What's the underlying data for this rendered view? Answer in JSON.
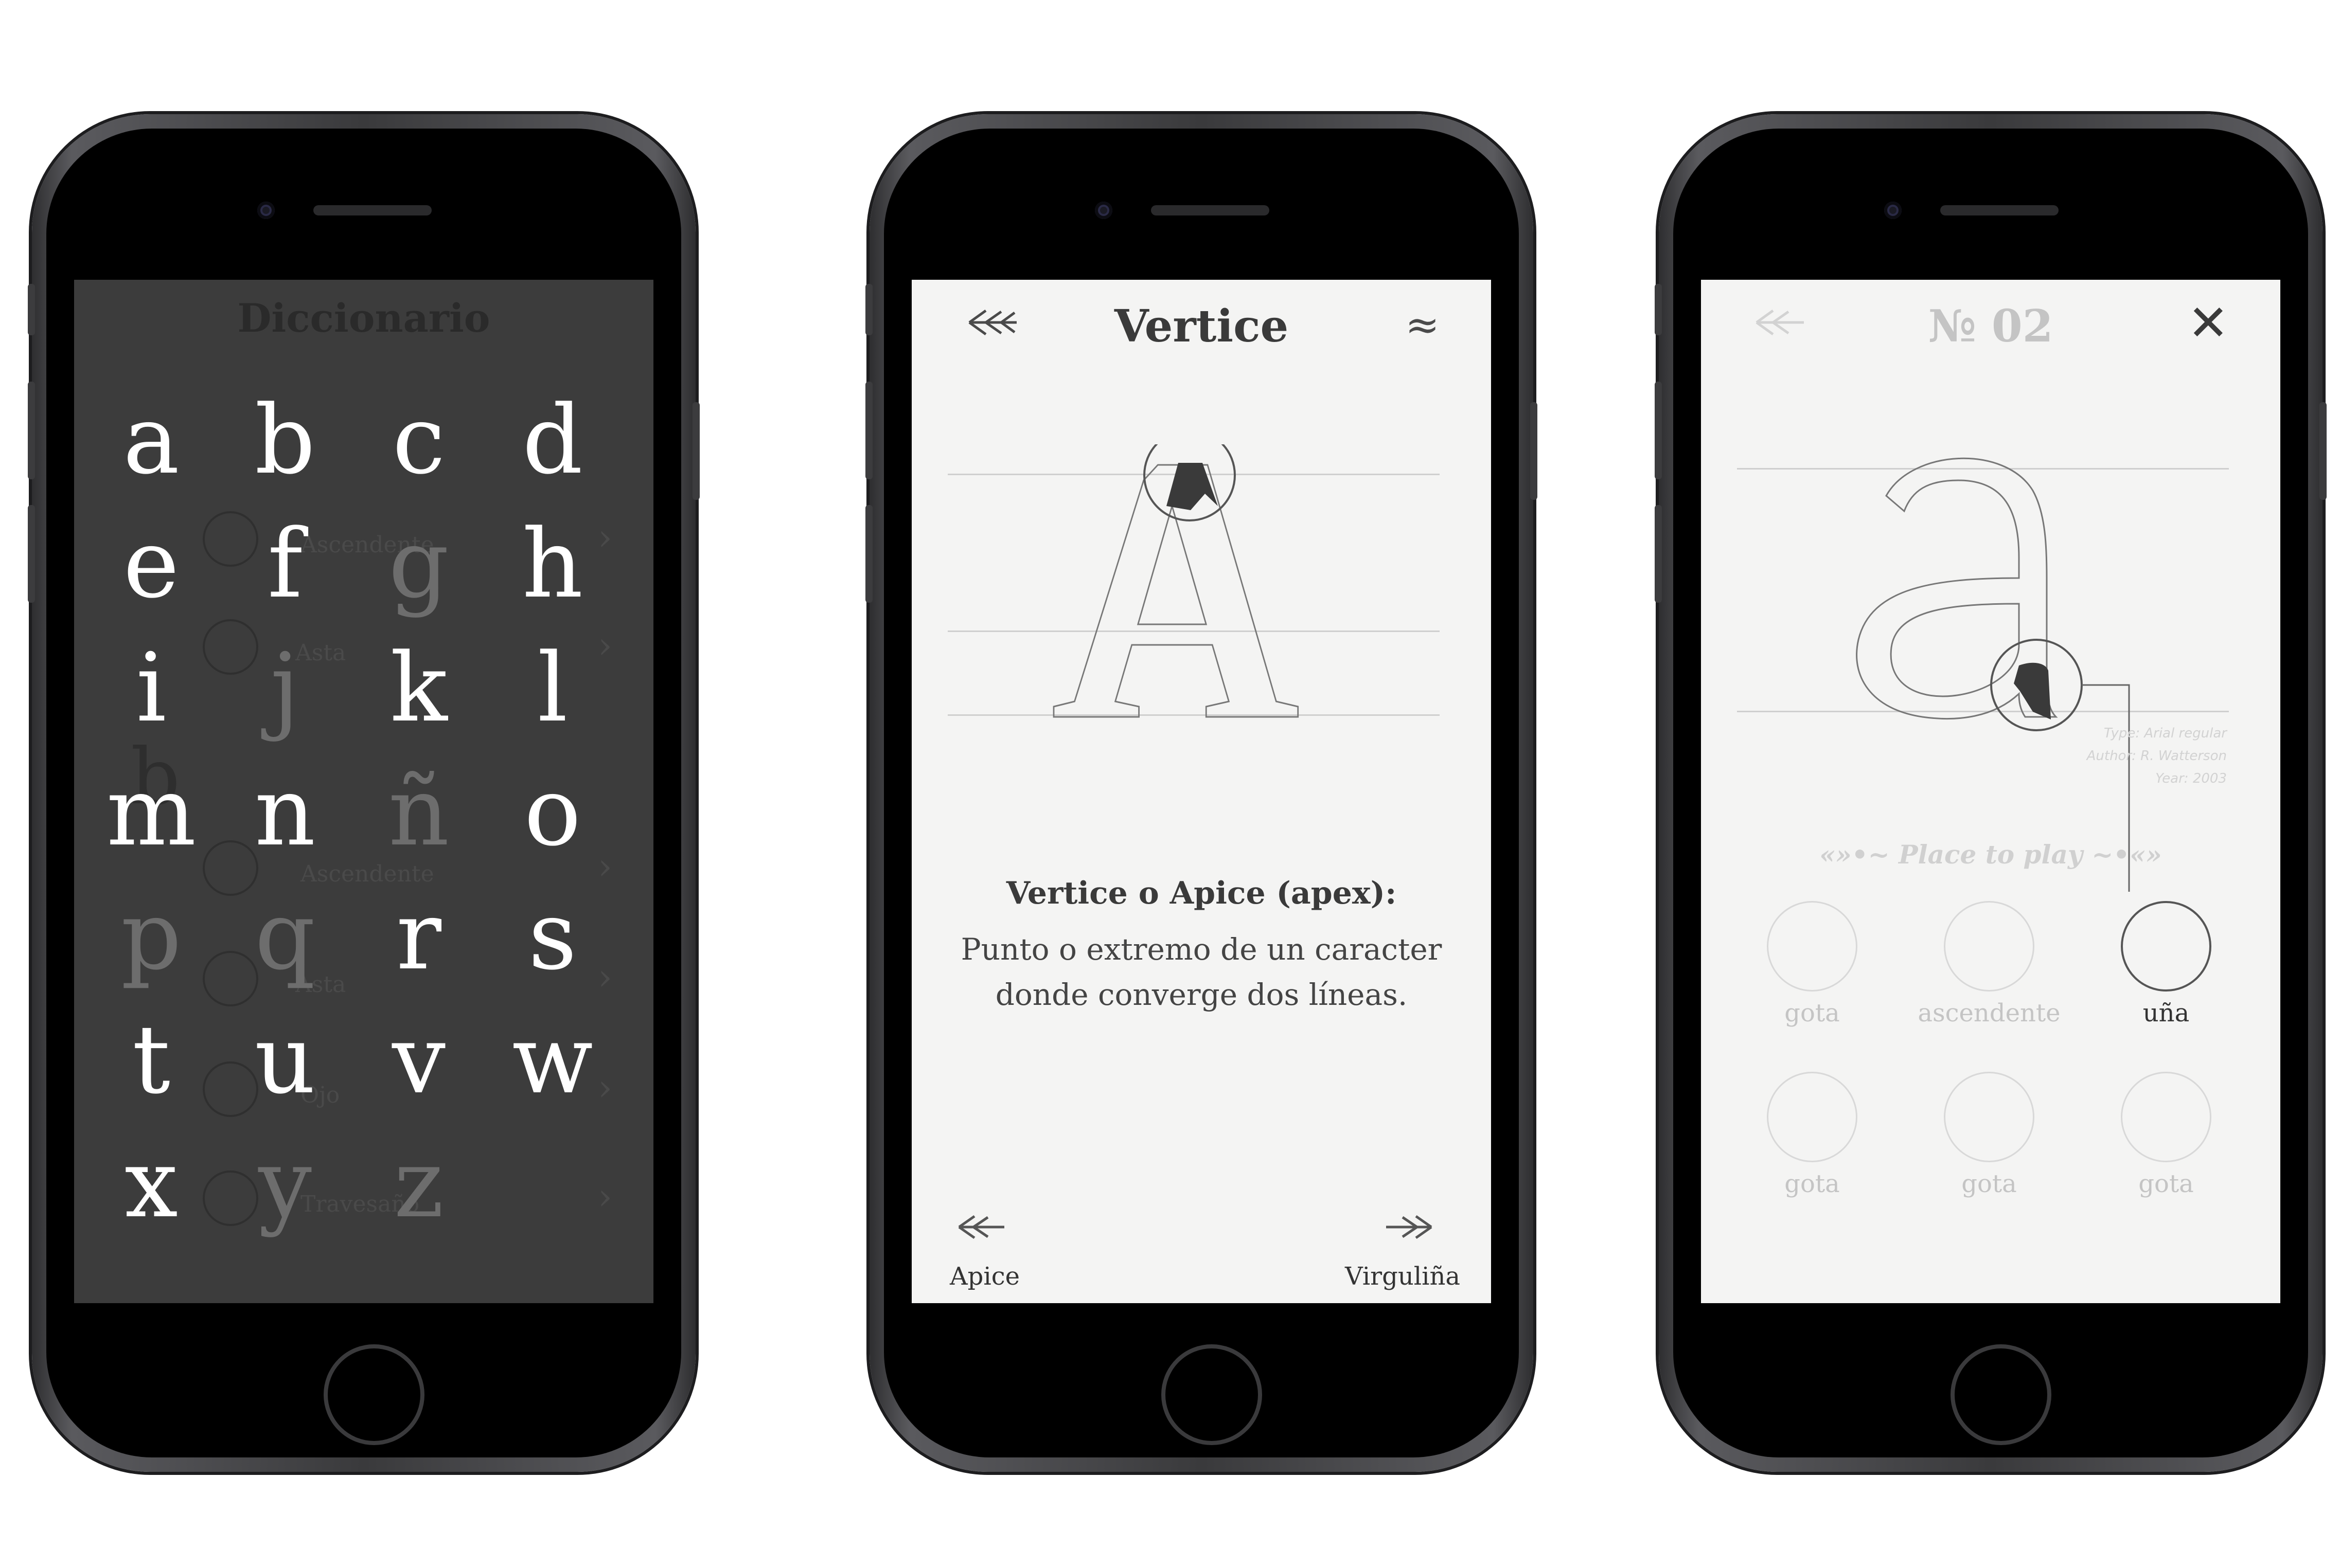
{
  "screen1": {
    "title": "Diccionario",
    "letters": [
      {
        "ch": "a",
        "active": true
      },
      {
        "ch": "b",
        "active": true
      },
      {
        "ch": "c",
        "active": true
      },
      {
        "ch": "d",
        "active": true
      },
      {
        "ch": "e",
        "active": true
      },
      {
        "ch": "f",
        "active": true
      },
      {
        "ch": "g",
        "active": false
      },
      {
        "ch": "h",
        "active": true
      },
      {
        "ch": "i",
        "active": true
      },
      {
        "ch": "j",
        "active": false
      },
      {
        "ch": "k",
        "active": true
      },
      {
        "ch": "l",
        "active": true
      },
      {
        "ch": "m",
        "active": true
      },
      {
        "ch": "n",
        "active": true
      },
      {
        "ch": "ñ",
        "active": false
      },
      {
        "ch": "o",
        "active": true
      },
      {
        "ch": "p",
        "active": false
      },
      {
        "ch": "q",
        "active": false
      },
      {
        "ch": "r",
        "active": true
      },
      {
        "ch": "s",
        "active": true
      },
      {
        "ch": "t",
        "active": true
      },
      {
        "ch": "u",
        "active": true
      },
      {
        "ch": "v",
        "active": true
      },
      {
        "ch": "w",
        "active": true
      },
      {
        "ch": "x",
        "active": true
      },
      {
        "ch": "y",
        "active": false
      },
      {
        "ch": "z",
        "active": false
      }
    ],
    "background_list": {
      "letter": "b",
      "items": [
        "Ascendente",
        "Asta",
        "Ascendente",
        "Asta",
        "Ojo",
        "Travesaño"
      ]
    }
  },
  "screen2": {
    "title": "Vertice",
    "back_icon": "feather-arrow-left-icon",
    "menu_icon": "≈",
    "glyph": "A",
    "description_title": "Vertice o Apice (apex):",
    "description_line1": "Punto o extremo de un caracter",
    "description_line2": "donde converge dos líneas.",
    "prev_label": "Apice",
    "next_label": "Virguliña"
  },
  "screen3": {
    "title": "№ 02",
    "close_icon": "✕",
    "glyph": "a",
    "meta_type": "Type: Arial regular",
    "meta_author": "Author: R. Watterson",
    "meta_year": "Year: 2003",
    "play_label": "«»•~ Place to play ~•«»",
    "slots": [
      {
        "label": "gota",
        "active": false
      },
      {
        "label": "ascendente",
        "active": false
      },
      {
        "label": "uña",
        "active": true
      },
      {
        "label": "gota",
        "active": false
      },
      {
        "label": "gota",
        "active": false
      },
      {
        "label": "gota",
        "active": false
      }
    ]
  },
  "colors": {
    "dark_screen": "#3c3c3c",
    "light_screen": "#f4f4f3",
    "accent": "#3a3a3a"
  }
}
